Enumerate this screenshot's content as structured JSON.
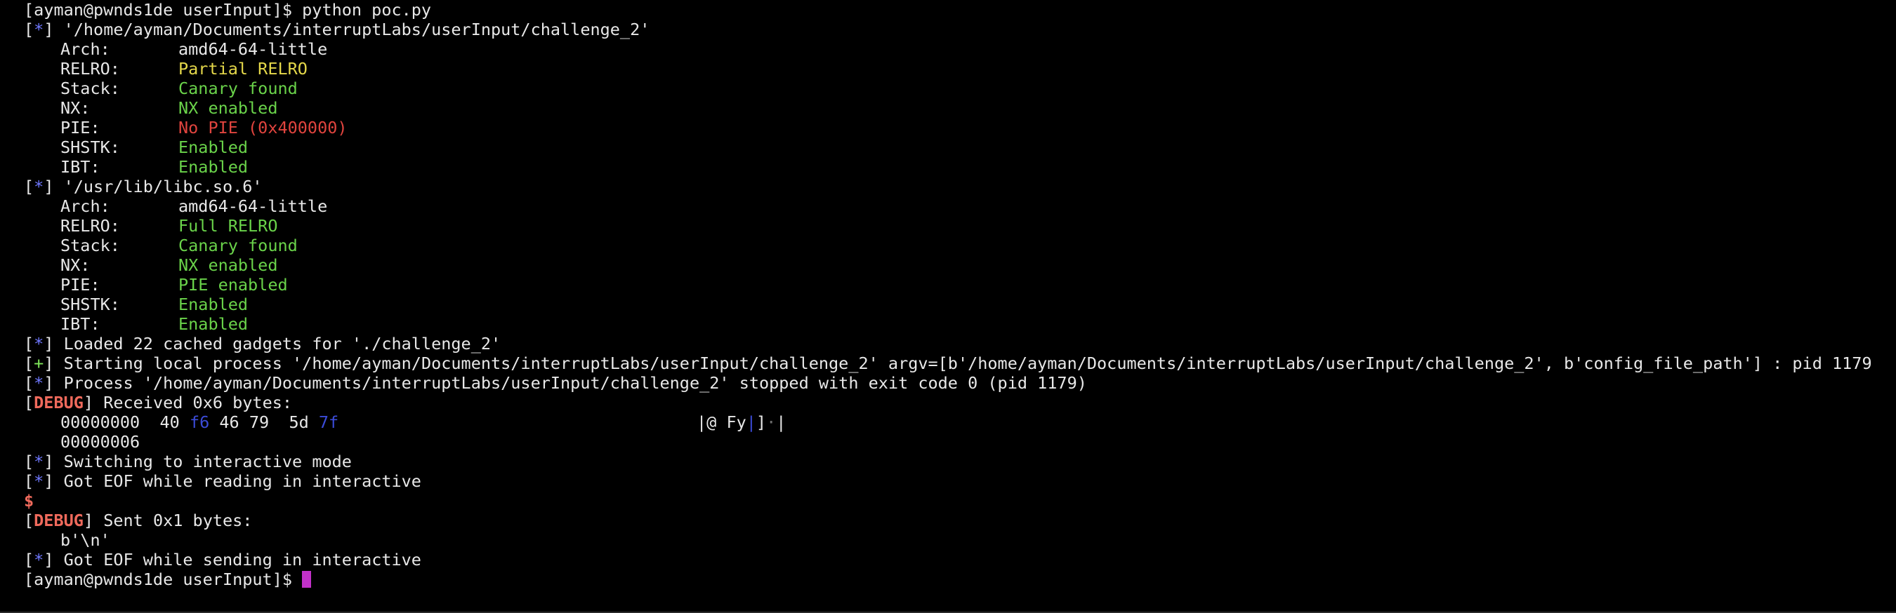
{
  "terminal": {
    "prompt_first": "[ayman@pwnds1de userInput]$ python poc.py",
    "binary1": {
      "marker": "*",
      "path": " '/home/ayman/Documents/interruptLabs/userInput/challenge_2'",
      "props": [
        {
          "label": "Arch:",
          "value": "amd64-64-little",
          "color": "white"
        },
        {
          "label": "RELRO:",
          "value": "Partial RELRO",
          "color": "yellow"
        },
        {
          "label": "Stack:",
          "value": "Canary found",
          "color": "green"
        },
        {
          "label": "NX:",
          "value": "NX enabled",
          "color": "green"
        },
        {
          "label": "PIE:",
          "value": "No PIE (0x400000)",
          "color": "red"
        },
        {
          "label": "SHSTK:",
          "value": "Enabled",
          "color": "green"
        },
        {
          "label": "IBT:",
          "value": "Enabled",
          "color": "green"
        }
      ]
    },
    "binary2": {
      "marker": "*",
      "path": " '/usr/lib/libc.so.6'",
      "props": [
        {
          "label": "Arch:",
          "value": "amd64-64-little",
          "color": "white"
        },
        {
          "label": "RELRO:",
          "value": "Full RELRO",
          "color": "green"
        },
        {
          "label": "Stack:",
          "value": "Canary found",
          "color": "green"
        },
        {
          "label": "NX:",
          "value": "NX enabled",
          "color": "green"
        },
        {
          "label": "PIE:",
          "value": "PIE enabled",
          "color": "green"
        },
        {
          "label": "SHSTK:",
          "value": "Enabled",
          "color": "green"
        },
        {
          "label": "IBT:",
          "value": "Enabled",
          "color": "green"
        }
      ]
    },
    "loaded_gadgets": " Loaded 22 cached gadgets for './challenge_2'",
    "starting_marker": "+",
    "starting_process": " Starting local process '/home/ayman/Documents/interruptLabs/userInput/challenge_2' argv=[b'/home/ayman/Documents/interruptLabs/userInput/challenge_2', b'config_file_path'] : pid 1179",
    "process_stopped": " Process '/home/ayman/Documents/interruptLabs/userInput/challenge_2' stopped with exit code 0 (pid 1179)",
    "debug_tag": "DEBUG",
    "received": " Received 0x6 bytes:",
    "hexdump": {
      "offset": "00000000",
      "b1": "40",
      "b2": "f6",
      "b3": "46",
      "b4": "79",
      "b5": "5d",
      "b6": "7f",
      "ascii_bar_open": "|",
      "ascii_text": "@ Fy",
      "ascii_sep": "|",
      "ascii_rest": "]",
      "ascii_end": "|",
      "end_offset": "00000006"
    },
    "switching": " Switching to interactive mode",
    "eof_reading": " Got EOF while reading in interactive",
    "dollar": "$",
    "sent": " Sent 0x1 bytes:",
    "sent_bytes": "b'\\n'",
    "eof_sending": " Got EOF while sending in interactive",
    "prompt_last": "[ayman@pwnds1de userInput]$ "
  }
}
